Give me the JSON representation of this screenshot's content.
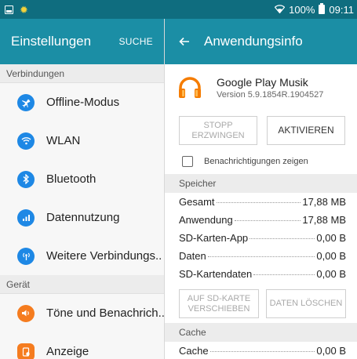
{
  "status_bar": {
    "battery": "100%",
    "time": "09:11",
    "icons": [
      "gallery-icon",
      "brightness-icon",
      "wifi-icon",
      "battery-icon"
    ]
  },
  "left_panel": {
    "title": "Einstellungen",
    "search_label": "SUCHE",
    "sections": [
      {
        "header": "Verbindungen",
        "items": [
          {
            "label": "Offline-Modus",
            "icon": "airplane-icon",
            "color": "#1e88e5"
          },
          {
            "label": "WLAN",
            "icon": "wifi-icon",
            "color": "#1e88e5"
          },
          {
            "label": "Bluetooth",
            "icon": "bluetooth-icon",
            "color": "#1e88e5"
          },
          {
            "label": "Datennutzung",
            "icon": "data-usage-icon",
            "color": "#1e88e5"
          },
          {
            "label": "Weitere Verbindungs..",
            "icon": "more-connections-icon",
            "color": "#1e88e5"
          }
        ]
      },
      {
        "header": "Gerät",
        "items": [
          {
            "label": "Töne und Benachrich..",
            "icon": "sound-icon",
            "color": "#f57c1f"
          },
          {
            "label": "Anzeige",
            "icon": "display-icon",
            "color": "#f57c1f"
          }
        ]
      }
    ]
  },
  "right_panel": {
    "title": "Anwendungsinfo",
    "app": {
      "name": "Google Play Musik",
      "version": "Version 5.9.1854R.1904527",
      "icon": "headphones-icon",
      "icon_color": "#f57c00"
    },
    "buttons": {
      "force_stop": "STOPP\nERZWINGEN",
      "activate": "AKTIVIEREN"
    },
    "notifications_label": "Benachrichtigungen zeigen",
    "notifications_checked": false,
    "storage": {
      "header": "Speicher",
      "rows": [
        {
          "label": "Gesamt",
          "value": "17,88 MB"
        },
        {
          "label": "Anwendung",
          "value": "17,88 MB"
        },
        {
          "label": "SD-Karten-App",
          "value": "0,00 B"
        },
        {
          "label": "Daten",
          "value": "0,00 B"
        },
        {
          "label": "SD-Kartendaten",
          "value": "0,00 B"
        }
      ],
      "move_button": "AUF SD-KARTE\nVERSCHIEBEN",
      "clear_data_button": "DATEN LÖSCHEN"
    },
    "cache": {
      "header": "Cache",
      "rows": [
        {
          "label": "Cache",
          "value": "0,00 B"
        }
      ]
    }
  },
  "colors": {
    "status_bar": "#0f6d7f",
    "header": "#1b8ea5",
    "blue_icon": "#1e88e5",
    "orange_icon": "#f57c1f"
  }
}
